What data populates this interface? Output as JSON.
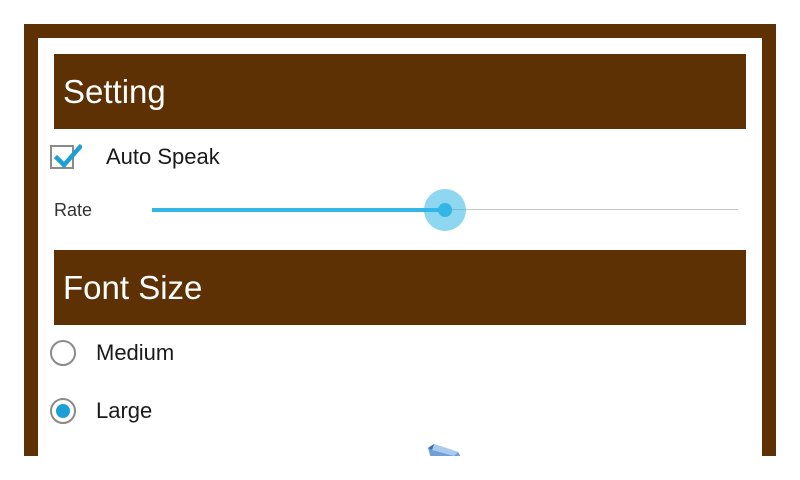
{
  "setting": {
    "title": "Setting",
    "auto_speak": {
      "label": "Auto Speak",
      "checked": true
    },
    "rate": {
      "label": "Rate",
      "value_fraction": 0.5
    }
  },
  "font_size": {
    "title": "Font Size",
    "options": [
      {
        "label": "Medium",
        "selected": false
      },
      {
        "label": "Large",
        "selected": true
      }
    ]
  },
  "colors": {
    "header_brown": "#5e3105",
    "accent_blue": "#33b5e5"
  },
  "icons": {
    "partial_bottom_icon": "speaker-icon"
  }
}
